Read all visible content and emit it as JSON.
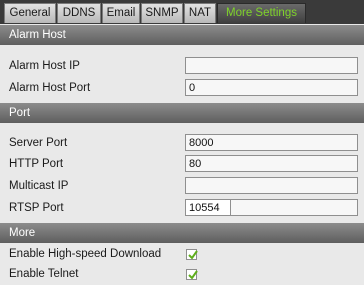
{
  "tabs": [
    {
      "label": "General"
    },
    {
      "label": "DDNS"
    },
    {
      "label": "Email"
    },
    {
      "label": "SNMP"
    },
    {
      "label": "NAT"
    },
    {
      "label": "More Settings",
      "active": true
    }
  ],
  "colors": {
    "active_tab_text": "#7fd32a",
    "checkmark": "#5fae1c",
    "section_header": "#6e6e6e"
  },
  "sections": {
    "alarm_host": {
      "title": "Alarm Host",
      "alarm_host_ip": {
        "label": "Alarm Host IP",
        "value": ""
      },
      "alarm_host_port": {
        "label": "Alarm Host Port",
        "value": "0"
      }
    },
    "port": {
      "title": "Port",
      "server_port": {
        "label": "Server Port",
        "value": "8000"
      },
      "http_port": {
        "label": "HTTP Port",
        "value": "80"
      },
      "multicast_ip": {
        "label": "Multicast IP",
        "value": ""
      },
      "rtsp_port": {
        "label": "RTSP Port",
        "value": "10554"
      }
    },
    "more": {
      "title": "More",
      "high_speed_download": {
        "label": "Enable High-speed Download",
        "checked": true
      },
      "telnet": {
        "label": "Enable Telnet",
        "checked": true
      }
    }
  },
  "icons": {
    "checkbox_mark": "check-icon"
  }
}
